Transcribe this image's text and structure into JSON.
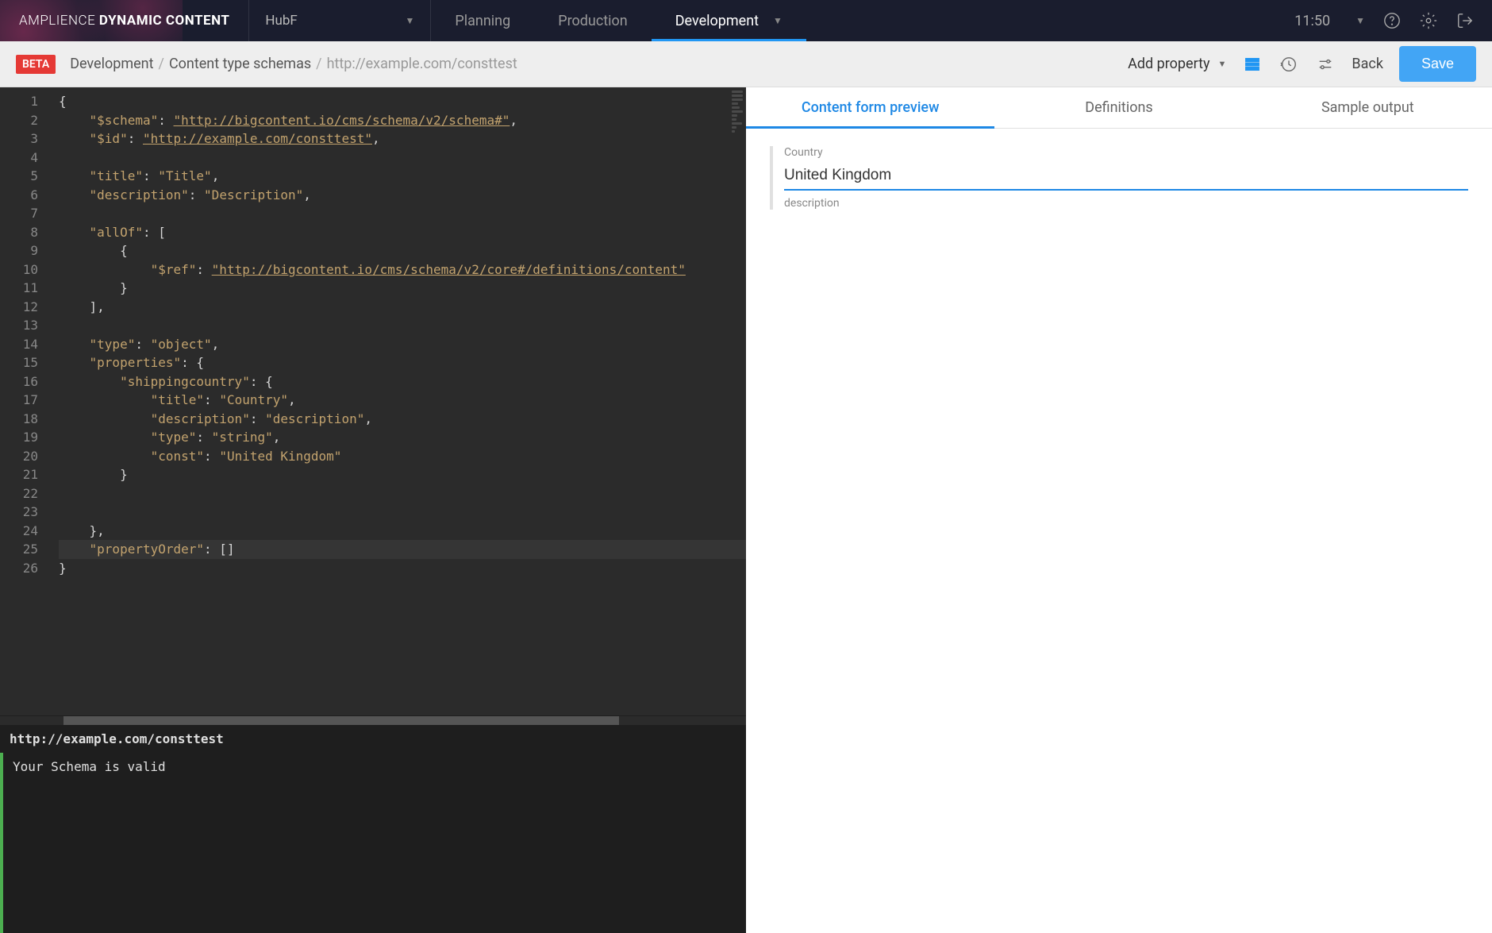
{
  "brand": {
    "light": "AMPLIENCE ",
    "bold": "DYNAMIC CONTENT"
  },
  "hub": "HubF",
  "nav": [
    {
      "label": "Planning",
      "active": false,
      "hasChevron": false
    },
    {
      "label": "Production",
      "active": false,
      "hasChevron": false
    },
    {
      "label": "Development",
      "active": true,
      "hasChevron": true
    }
  ],
  "time": "11:50",
  "beta": "BETA",
  "breadcrumb": {
    "p1": "Development",
    "p2": "Content type schemas",
    "p3": "http://example.com/consttest"
  },
  "toolbar": {
    "addProperty": "Add property",
    "back": "Back",
    "save": "Save"
  },
  "editor": {
    "lineCount": 26,
    "activeLine": 25,
    "lines": [
      "{",
      "    \"$schema\": \"http://bigcontent.io/cms/schema/v2/schema#\",",
      "    \"$id\": \"http://example.com/consttest\",",
      "",
      "    \"title\": \"Title\",",
      "    \"description\": \"Description\",",
      "",
      "    \"allOf\": [",
      "        {",
      "            \"$ref\": \"http://bigcontent.io/cms/schema/v2/core#/definitions/content\"",
      "        }",
      "    ],",
      "",
      "    \"type\": \"object\",",
      "    \"properties\": {",
      "        \"shippingcountry\": {",
      "            \"title\": \"Country\",",
      "            \"description\": \"description\",",
      "            \"type\": \"string\",",
      "            \"const\": \"United Kingdom\"",
      "        }",
      "",
      "",
      "    },",
      "    \"propertyOrder\": []",
      "}"
    ]
  },
  "status": {
    "url": "http://example.com/consttest",
    "message": "Your Schema is valid"
  },
  "previewTabs": [
    {
      "label": "Content form preview",
      "active": true
    },
    {
      "label": "Definitions",
      "active": false
    },
    {
      "label": "Sample output",
      "active": false
    }
  ],
  "form": {
    "label": "Country",
    "value": "United Kingdom",
    "description": "description"
  }
}
